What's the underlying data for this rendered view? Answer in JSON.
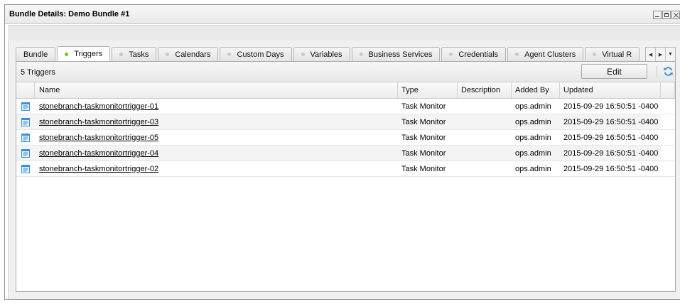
{
  "window": {
    "title": "Bundle Details: Demo Bundle #1"
  },
  "tabs": [
    {
      "label": "Bundle",
      "dot": false,
      "active": false
    },
    {
      "label": "Triggers",
      "dot": true,
      "active": true
    },
    {
      "label": "Tasks",
      "dot": true,
      "active": false
    },
    {
      "label": "Calendars",
      "dot": true,
      "active": false
    },
    {
      "label": "Custom Days",
      "dot": true,
      "active": false
    },
    {
      "label": "Variables",
      "dot": true,
      "active": false
    },
    {
      "label": "Business Services",
      "dot": true,
      "active": false
    },
    {
      "label": "Credentials",
      "dot": true,
      "active": false
    },
    {
      "label": "Agent Clusters",
      "dot": true,
      "active": false
    },
    {
      "label": "Virtual R",
      "dot": true,
      "active": false
    }
  ],
  "panel": {
    "count_label": "5 Triggers",
    "edit_label": "Edit"
  },
  "table": {
    "columns": {
      "name": "Name",
      "type": "Type",
      "description": "Description",
      "added_by": "Added By",
      "updated": "Updated"
    },
    "rows": [
      {
        "name": "stonebranch-taskmonitortrigger-01",
        "type": "Task Monitor",
        "description": "",
        "added_by": "ops.admin",
        "updated": "2015-09-29 16:50:51 -0400"
      },
      {
        "name": "stonebranch-taskmonitortrigger-03",
        "type": "Task Monitor",
        "description": "",
        "added_by": "ops.admin",
        "updated": "2015-09-29 16:50:51 -0400"
      },
      {
        "name": "stonebranch-taskmonitortrigger-05",
        "type": "Task Monitor",
        "description": "",
        "added_by": "ops.admin",
        "updated": "2015-09-29 16:50:51 -0400"
      },
      {
        "name": "stonebranch-taskmonitortrigger-04",
        "type": "Task Monitor",
        "description": "",
        "added_by": "ops.admin",
        "updated": "2015-09-29 16:50:51 -0400"
      },
      {
        "name": "stonebranch-taskmonitortrigger-02",
        "type": "Task Monitor",
        "description": "",
        "added_by": "ops.admin",
        "updated": "2015-09-29 16:50:51 -0400"
      }
    ]
  },
  "icons": {
    "trigger_row": "trigger-document-icon",
    "refresh": "refresh-icon",
    "tab_scroll_left": "chevron-left-icon",
    "tab_scroll_right": "chevron-right-icon",
    "tab_menu": "chevron-down-icon"
  },
  "colors": {
    "active_dot": "#6abf2c",
    "inactive_dot": "#c8c8c8",
    "icon_blue": "#3a8fd6"
  }
}
